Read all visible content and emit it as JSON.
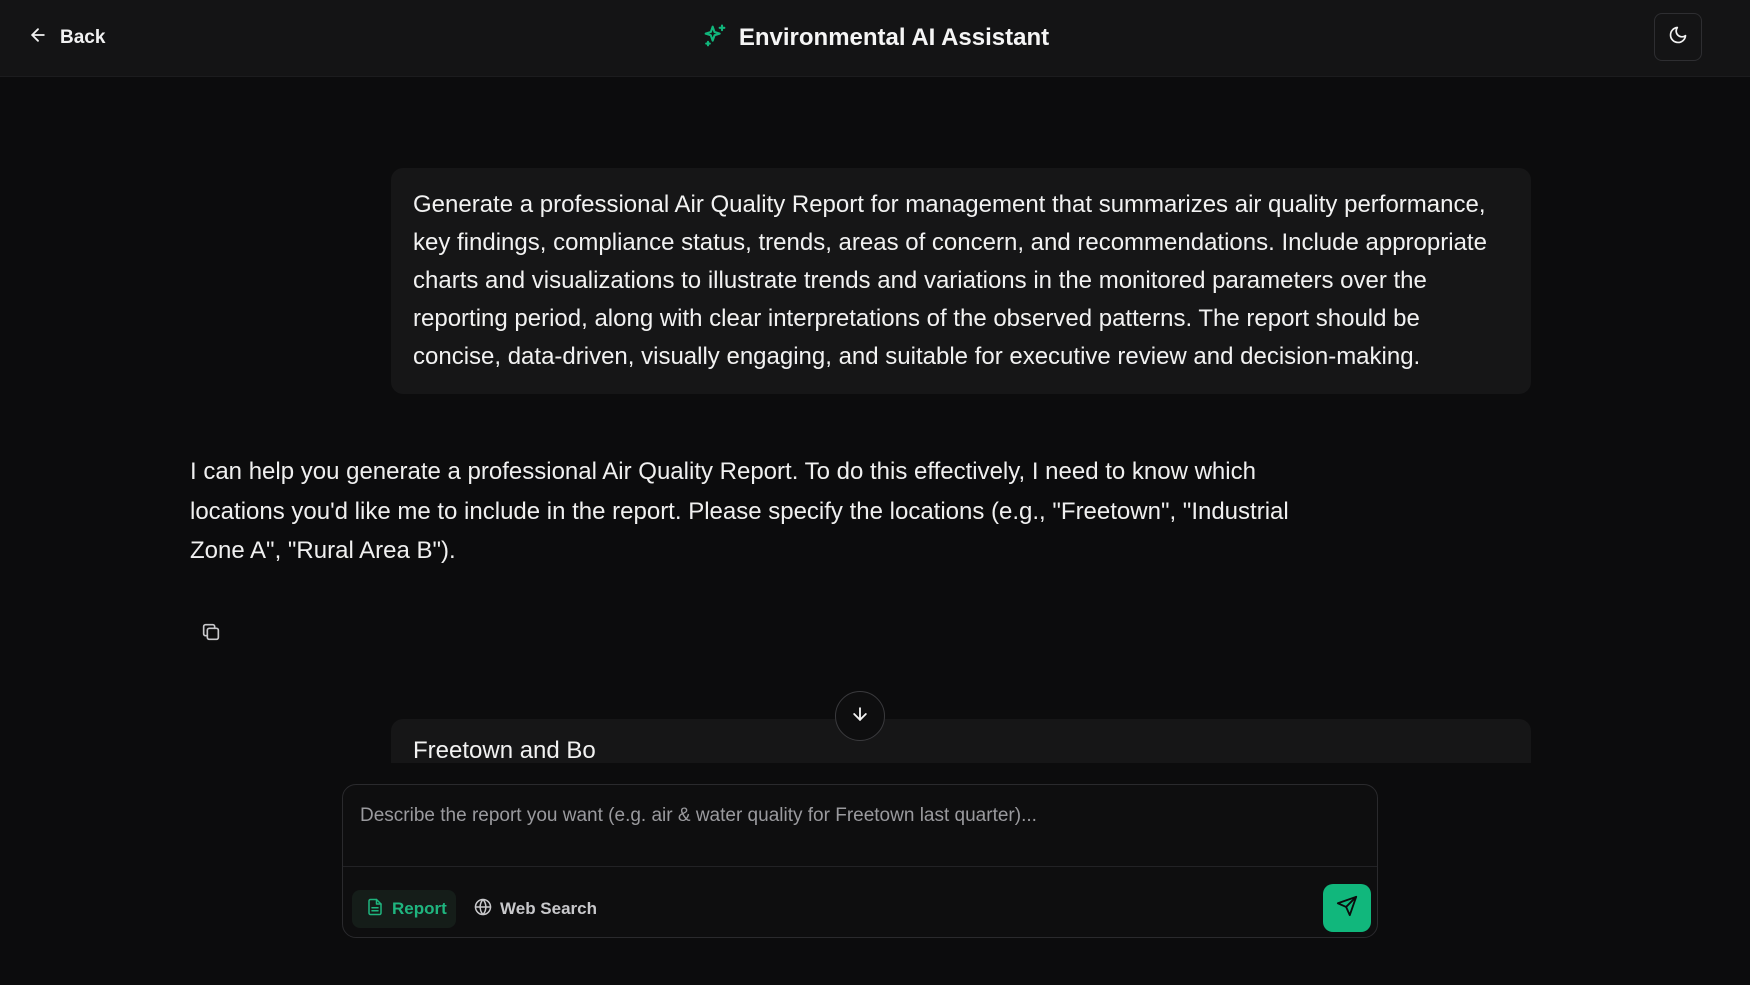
{
  "header": {
    "back_label": "Back",
    "title": "Environmental AI Assistant"
  },
  "messages": {
    "user_1": "Generate a professional Air Quality Report for management that summarizes air quality performance, key findings, compliance status, trends, areas of concern, and recommendations. Include appropriate charts and visualizations to illustrate trends and variations in the monitored parameters over the reporting period, along with clear interpretations of the observed patterns. The report should be concise, data-driven, visually engaging, and suitable for executive review and decision-making.",
    "assistant_1": "I can help you generate a professional Air Quality Report. To do this effectively, I need to know which locations you'd like me to include in the report. Please specify the locations (e.g., \"Freetown\", \"Industrial Zone A\", \"Rural Area B\").",
    "user_2": "Freetown and Bo"
  },
  "composer": {
    "placeholder": "Describe the report you want (e.g. air & water quality for Freetown last quarter)...",
    "value": "",
    "mode_report_label": "Report",
    "mode_web_label": "Web Search"
  },
  "icons": {
    "back": "arrow-left-icon",
    "title": "sparkles-icon",
    "theme": "moon-icon",
    "copy": "copy-icon",
    "scroll": "arrow-down-icon",
    "report": "file-text-icon",
    "web": "globe-icon",
    "send": "send-icon"
  },
  "colors": {
    "accent": "#11b77c",
    "background": "#0c0c0d",
    "header": "#141415",
    "bubble": "#161617"
  }
}
